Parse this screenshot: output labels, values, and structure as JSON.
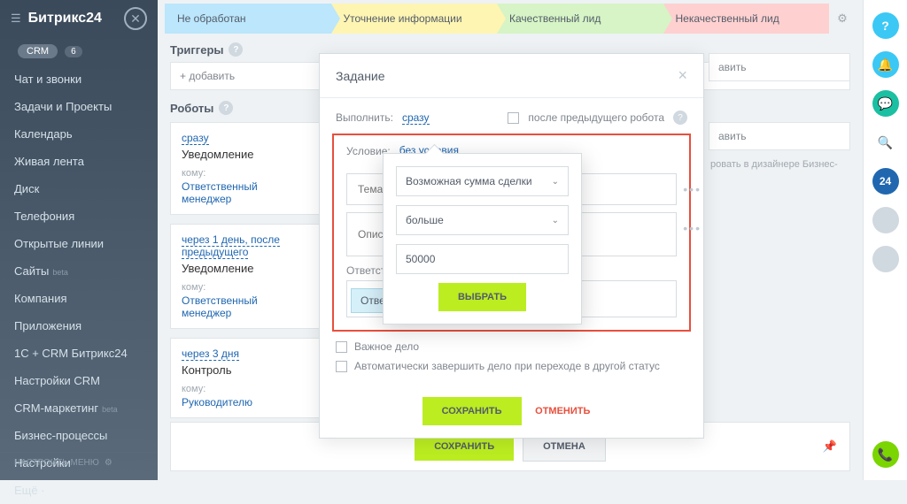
{
  "sidebar": {
    "logo": "Битрикс24",
    "crm_label": "CRM",
    "crm_count": "6",
    "items": [
      {
        "label": "Чат и звонки"
      },
      {
        "label": "Задачи и Проекты"
      },
      {
        "label": "Календарь"
      },
      {
        "label": "Живая лента"
      },
      {
        "label": "Диск"
      },
      {
        "label": "Телефония"
      },
      {
        "label": "Открытые линии"
      },
      {
        "label": "Сайты",
        "beta": "beta"
      },
      {
        "label": "Компания"
      },
      {
        "label": "Приложения"
      },
      {
        "label": "1С + CRM Битрикс24"
      },
      {
        "label": "Настройки CRM"
      },
      {
        "label": "CRM-маркетинг",
        "beta": "beta"
      },
      {
        "label": "Бизнес-процессы"
      },
      {
        "label": "Настройки"
      },
      {
        "label": "Ещё ·"
      }
    ],
    "footer": "НАСТРОИТЬ МЕНЮ"
  },
  "stages": [
    {
      "label": "Не обработан"
    },
    {
      "label": "Уточнение информации"
    },
    {
      "label": "Качественный лид"
    },
    {
      "label": "Некачественный лид"
    }
  ],
  "sections": {
    "triggers": "Триггеры",
    "robots": "Роботы",
    "add": "+ добавить",
    "designer_note": "Редактировать в дизайнере Бизнес-..."
  },
  "robots": [
    {
      "when": "сразу",
      "title": "Уведомление",
      "to_label": "кому:",
      "to": "Ответственный менеджер"
    },
    {
      "when": "через 1 день, после предыдущего",
      "title": "Уведомление",
      "to_label": "кому:",
      "to": "Ответственный менеджер"
    },
    {
      "when": "через 3 дня",
      "title": "Контроль",
      "to_label": "кому:",
      "to": "Руководителю"
    }
  ],
  "right": {
    "add": "авить",
    "note": "ровать в дизайнере Бизнес-"
  },
  "modal": {
    "title": "Задание",
    "execute_label": "Выполнить:",
    "execute_link": "сразу",
    "after_prev": "после предыдущего робота",
    "condition_label": "Условие:",
    "condition_link": "без условия",
    "subject_ph": "Тема",
    "desc_ph": "Опис",
    "resp_label": "Ответстве",
    "resp_tag": "Ответс",
    "important": "Важное дело",
    "auto_complete": "Автоматически завершить дело при переходе в другой статус",
    "save": "СОХРАНИТЬ",
    "cancel": "ОТМЕНИТЬ"
  },
  "popup": {
    "field": "Возможная сумма сделки",
    "operator": "больше",
    "value": "50000",
    "select": "ВЫБРАТЬ"
  },
  "bottom": {
    "save": "СОХРАНИТЬ",
    "cancel": "ОТМЕНА"
  },
  "rail": {
    "badge": "24"
  }
}
